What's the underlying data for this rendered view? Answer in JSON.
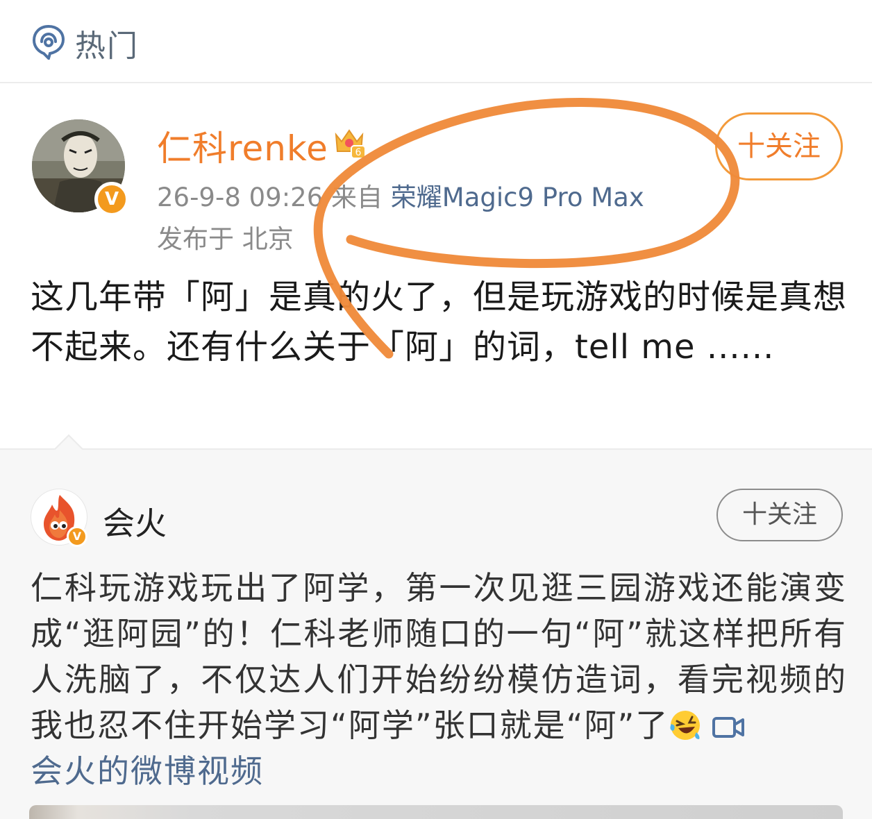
{
  "header": {
    "title": "热门",
    "icon": "hot-topic-icon"
  },
  "post": {
    "username": "仁科renke",
    "badge_icon": "crown-badge-icon",
    "badge_level": "6",
    "verified_mark": "V",
    "time": "26-9-8 09:26",
    "source_prefix": "来自",
    "device": "荣耀Magic9 Pro Max",
    "location": "发布于 北京",
    "follow_label": "十关注",
    "text": "这几年带「阿」是真的火了，但是玩游戏的时候是真想不起来。还有什么关于「阿」的词，tell me ......"
  },
  "repost": {
    "username": "会火",
    "verified_mark": "V",
    "follow_label": "十关注",
    "text": "仁科玩游戏玩出了阿学，第一次见逛三园游戏还能演变成“逛阿园”的！仁科老师随口的一句“阿”就这样把所有人洗脑了，不仅达人们开始纷纷模仿造词，看完视频的我也忍不住开始学习“阿学”张口就是“阿”了",
    "emoji_icon": "laughing-tears-emoji-icon",
    "video_icon": "video-camera-icon",
    "link_text": "会火的微博视频"
  },
  "colors": {
    "username_orange": "#f07d2b",
    "link_blue": "#4f6a8e",
    "annotation_orange": "#ef8a3a",
    "verified_badge": "#f39a1e"
  }
}
